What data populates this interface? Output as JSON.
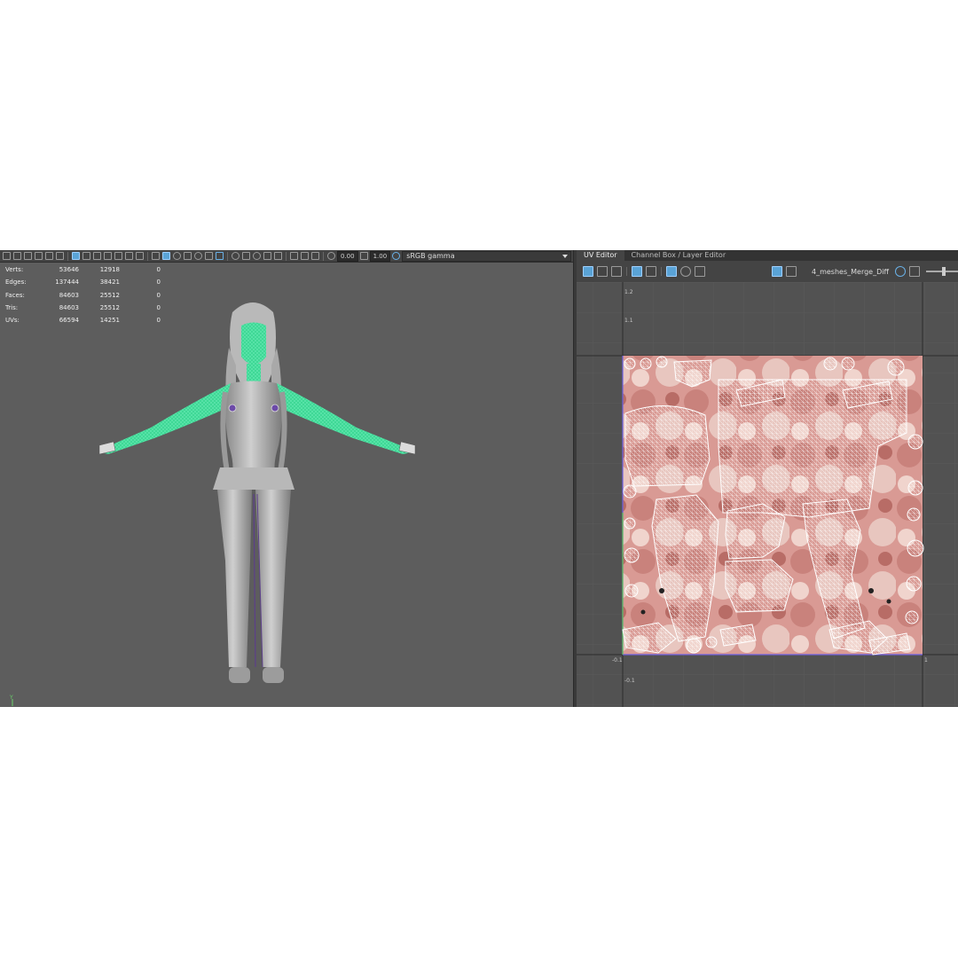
{
  "viewport": {
    "toolbar": {
      "exposure_value": "0.00",
      "gamma_value": "1.00",
      "color_space": "sRGB gamma"
    },
    "hud": {
      "rows": [
        {
          "label": "Verts:",
          "v1": "53646",
          "v2": "12918",
          "v3": "0"
        },
        {
          "label": "Edges:",
          "v1": "137444",
          "v2": "38421",
          "v3": "0"
        },
        {
          "label": "Faces:",
          "v1": "84603",
          "v2": "25512",
          "v3": "0"
        },
        {
          "label": "Tris:",
          "v1": "84603",
          "v2": "25512",
          "v3": "0"
        },
        {
          "label": "UVs:",
          "v1": "66594",
          "v2": "14251",
          "v3": "0"
        }
      ]
    },
    "axis_label": "Y"
  },
  "uv_editor": {
    "tabs": [
      {
        "label": "UV Editor",
        "active": true
      },
      {
        "label": "Channel Box / Layer Editor",
        "active": false
      }
    ],
    "texture_name": "4_meshes_Merge_Diff",
    "ticks": {
      "top": "1.2",
      "top2": "1.1",
      "left": "-0.1",
      "right": "1",
      "bottom": "-0.1"
    }
  },
  "colors": {
    "viewport_bg": "#5d5d5d",
    "uv_bg": "#525252",
    "selection_green": "#44e0a0",
    "active_icon": "#5aa3d6"
  }
}
